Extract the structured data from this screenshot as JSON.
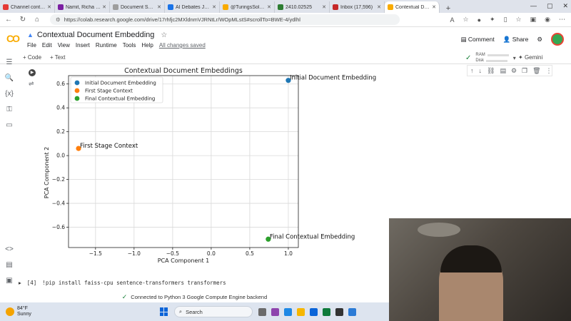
{
  "browser": {
    "tabs": [
      {
        "label": "Channel content",
        "color": "#e53935"
      },
      {
        "label": "Namit, Richa M...",
        "color": "#7b1fa2"
      },
      {
        "label": "Document Summ",
        "color": "#9e9e9e"
      },
      {
        "label": "AI Debates Johl",
        "color": "#1a73e8"
      },
      {
        "label": "@TuringsSolutio",
        "color": "#f9ab00"
      },
      {
        "label": "2410.02525",
        "color": "#2e7d32"
      },
      {
        "label": "Inbox (17,596)",
        "color": "#c62828"
      },
      {
        "label": "Contextual Doc...",
        "color": "#f9ab00"
      }
    ],
    "url": "https://colab.research.google.com/drive/17rhfjc2MXldnmVJRNtLr/WOpMLstS#scrollTo=BWE-4/ydlhl"
  },
  "colab": {
    "logo": "CO",
    "title": "Contextual Document Embedding",
    "menu": [
      "File",
      "Edit",
      "View",
      "Insert",
      "Runtime",
      "Tools",
      "Help"
    ],
    "saved_status": "All changes saved",
    "comment_label": "Comment",
    "share_label": "Share",
    "add_code": "+ Code",
    "add_text": "+ Text",
    "ram_label": "RAM",
    "disk_label": "Disk",
    "gemini_label": "Gemini"
  },
  "chart_data": {
    "type": "scatter",
    "title": "Contextual Document Embeddings",
    "xlabel": "PCA Component 1",
    "ylabel": "PCA Component 2",
    "xlim": [
      -1.85,
      1.13
    ],
    "ylim": [
      -0.77,
      0.67
    ],
    "xticks": [
      -1.5,
      -1.0,
      -0.5,
      0.0,
      0.5,
      1.0
    ],
    "xtick_labels": [
      "−1.5",
      "−1.0",
      "−0.5",
      "0.0",
      "0.5",
      "1.0"
    ],
    "yticks": [
      -0.6,
      -0.4,
      -0.2,
      0.0,
      0.2,
      0.4,
      0.6
    ],
    "ytick_labels": [
      "−0.6",
      "−0.4",
      "−0.2",
      "0.0",
      "0.2",
      "0.4",
      "0.6"
    ],
    "grid": true,
    "legend_position": "top-left",
    "series": [
      {
        "name": "Initial Document Embedding",
        "x": 1.0,
        "y": 0.63,
        "color": "#1f77b4",
        "annotation": "Initial Document Embedding"
      },
      {
        "name": "First Stage Context",
        "x": -1.72,
        "y": 0.06,
        "color": "#ff7f0e",
        "annotation": "First Stage Context"
      },
      {
        "name": "Final Contextual Embedding",
        "x": 0.74,
        "y": -0.7,
        "color": "#2ca02c",
        "annotation": "Final Contextual Embedding"
      }
    ]
  },
  "next_cell": {
    "exec_count": "[4]",
    "code": "!pip install faiss-cpu sentence-transformers transformers"
  },
  "status_bar": {
    "text": "Connected to Python 3 Google Compute Engine backend"
  },
  "taskbar": {
    "temperature": "84°F",
    "condition": "Sunny",
    "search_label": "Search"
  }
}
